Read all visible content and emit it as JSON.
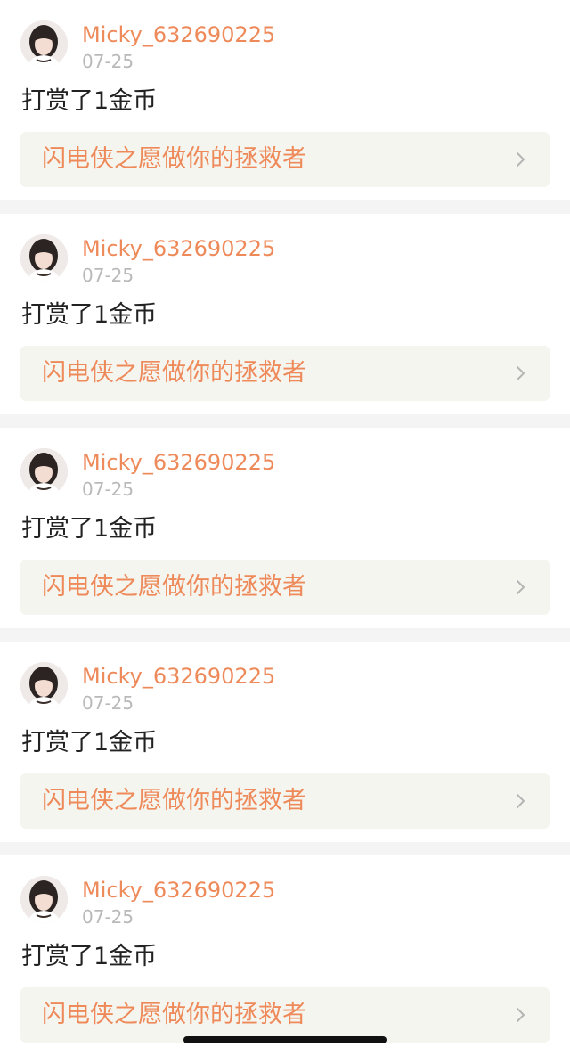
{
  "feed": {
    "items": [
      {
        "username": "Micky_632690225",
        "date": "07-25",
        "action": "打赏了1金币",
        "link_title": "闪电侠之愿做你的拯救者"
      },
      {
        "username": "Micky_632690225",
        "date": "07-25",
        "action": "打赏了1金币",
        "link_title": "闪电侠之愿做你的拯救者"
      },
      {
        "username": "Micky_632690225",
        "date": "07-25",
        "action": "打赏了1金币",
        "link_title": "闪电侠之愿做你的拯救者"
      },
      {
        "username": "Micky_632690225",
        "date": "07-25",
        "action": "打赏了1金币",
        "link_title": "闪电侠之愿做你的拯救者"
      },
      {
        "username": "Micky_632690225",
        "date": "07-25",
        "action": "打赏了1金币",
        "link_title": "闪电侠之愿做你的拯救者"
      }
    ]
  },
  "colors": {
    "accent": "#ee8a5a",
    "date_gray": "#b9b9b9",
    "link_box_bg": "#f5f5f0",
    "separator": "#f4f4f4",
    "text_primary": "#222222"
  },
  "icons": {
    "avatar": "user-avatar-photo",
    "chevron": "chevron-right-icon"
  }
}
